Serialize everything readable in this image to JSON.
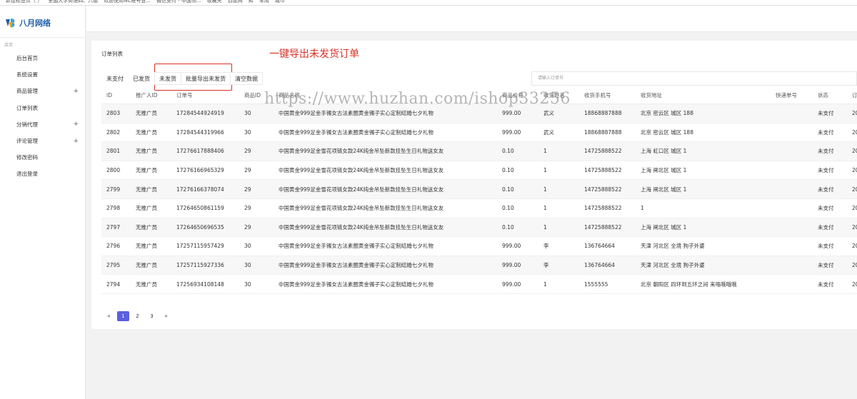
{
  "bookmarks": [
    "新建标签页（ ）",
    "全国大学英语四、六级",
    "欢迎使用NC账号登...",
    "微信支付 - 中国领...",
    "收藏夹",
    "百度网",
    "知",
    "常用",
    "城市"
  ],
  "sidebar": {
    "logo_text": "八月网络",
    "group_label": "菜单",
    "items": [
      {
        "label": "后台首页",
        "plus": ""
      },
      {
        "label": "系统设置",
        "plus": ""
      },
      {
        "label": "商品管理",
        "plus": "+"
      },
      {
        "label": "订单列表",
        "plus": ""
      },
      {
        "label": "分销代理",
        "plus": "+"
      },
      {
        "label": "评论管理",
        "plus": "+"
      },
      {
        "label": "修改密码",
        "plus": ""
      },
      {
        "label": "退出登录",
        "plus": ""
      }
    ]
  },
  "card": {
    "title": "订单列表",
    "annotation": "一键导出未发货订单",
    "tabs": [
      "未支付",
      "已发货",
      "未发货",
      "批量导出未发货",
      "清空数据"
    ],
    "search_placeholder": "请输入订单号"
  },
  "table": {
    "headers": [
      "ID",
      "推广人ID",
      "订单号",
      "商品ID",
      "商品名称",
      "商品价格",
      "收货姓名",
      "收货手机号",
      "收货地址",
      "快递单号",
      "状态",
      "订"
    ],
    "rows": [
      [
        "2803",
        "无推广员",
        "17284544924919",
        "30",
        "中国黄金999足金手镯女古法素圈黄金镯子实心定制结婚七夕礼物",
        "999.00",
        "武义",
        "18868887888",
        "北京 密云区 城区 188",
        "",
        "未支付",
        "20"
      ],
      [
        "2802",
        "无推广员",
        "17284544319966",
        "30",
        "中国黄金999足金手镯女古法素圈黄金镯子实心定制结婚七夕礼物",
        "999.00",
        "武义",
        "18868887888",
        "北京 密云区 城区 188",
        "",
        "未支付",
        "20"
      ],
      [
        "2801",
        "无推广员",
        "17276617888406",
        "29",
        "中国黄金999足金雪花项链女款24K纯金吊坠新款挂坠生日礼物送女友",
        "0.10",
        "1",
        "14725888522",
        "上海 虹口区 城区 1",
        "",
        "未支付",
        "20"
      ],
      [
        "2800",
        "无推广员",
        "17276166965329",
        "29",
        "中国黄金999足金雪花项链女款24K纯金吊坠新款挂坠生日礼物送女友",
        "0.10",
        "1",
        "14725888522",
        "上海 闸北区 城区 1",
        "",
        "未支付",
        "20"
      ],
      [
        "2799",
        "无推广员",
        "17276166378074",
        "29",
        "中国黄金999足金雪花项链女款24K纯金吊坠新款挂坠生日礼物送女友",
        "0.10",
        "1",
        "14725888522",
        "上海 闸北区 城区 1",
        "",
        "未支付",
        "20"
      ],
      [
        "2798",
        "无推广员",
        "17264650861159",
        "29",
        "中国黄金999足金雪花项链女款24K纯金吊坠新款挂坠生日礼物送女友",
        "0.10",
        "1",
        "14725888522",
        "1",
        "",
        "未支付",
        "20"
      ],
      [
        "2797",
        "无推广员",
        "17264650696535",
        "29",
        "中国黄金999足金雪花项链女款24K纯金吊坠新款挂坠生日礼物送女友",
        "0.10",
        "1",
        "14725888522",
        "上海 闸北区 城区 1",
        "",
        "未支付",
        "20"
      ],
      [
        "2796",
        "无推广员",
        "17257115957429",
        "30",
        "中国黄金999足金手镯女古法素圈黄金镯子实心定制结婚七夕礼物",
        "999.00",
        "李",
        "136764664",
        "天津 河北区 全境 狗子外婆",
        "",
        "未支付",
        "20"
      ],
      [
        "2795",
        "无推广员",
        "17257115927336",
        "30",
        "中国黄金999足金手镯女古法素圈黄金镯子实心定制结婚七夕礼物",
        "999.00",
        "李",
        "136764664",
        "天津 河北区 全境 狗子外婆",
        "",
        "未支付",
        "20"
      ],
      [
        "2794",
        "无推广员",
        "17256934108148",
        "30",
        "中国黄金999足金手镯女古法素圈黄金镯子实心定制结婚七夕礼物",
        "999.00",
        "1",
        "1555555",
        "北京 朝阳区 四环到五环之间 来咯哦哦哦",
        "",
        "未支付",
        "20"
      ]
    ]
  },
  "pagination": {
    "prev": "«",
    "pages": [
      "1",
      "2",
      "3"
    ],
    "next": "»",
    "current": "1"
  },
  "watermark": "https://www.huzhan.com/ishop33256",
  "colors": {
    "accent": "#5b5fe0",
    "annotation": "#d93025",
    "brand": "#1e5fa8"
  }
}
